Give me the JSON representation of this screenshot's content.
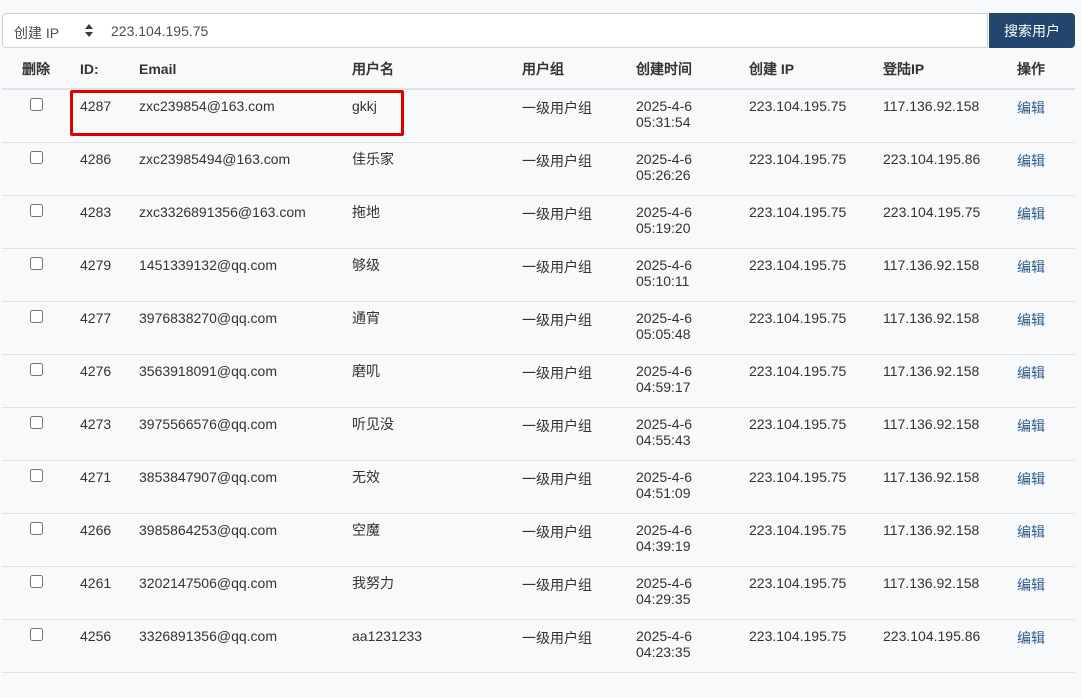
{
  "search": {
    "select_value": "创建 IP",
    "input_value": "223.104.195.75",
    "button_label": "搜索用户"
  },
  "table": {
    "headers": {
      "delete": "删除",
      "id": "ID:",
      "email": "Email",
      "username": "用户名",
      "group": "用户组",
      "created_time": "创建时间",
      "create_ip": "创建 IP",
      "login_ip": "登陆IP",
      "action": "操作"
    },
    "rows": [
      {
        "id": "4287",
        "email": "zxc239854@163.com",
        "username": "gkkj",
        "group": "一级用户组",
        "date": "2025-4-6",
        "time": "05:31:54",
        "create_ip": "223.104.195.75",
        "login_ip": "117.136.92.158",
        "action": "编辑"
      },
      {
        "id": "4286",
        "email": "zxc23985494@163.com",
        "username": "佳乐家",
        "group": "一级用户组",
        "date": "2025-4-6",
        "time": "05:26:26",
        "create_ip": "223.104.195.75",
        "login_ip": "223.104.195.86",
        "action": "编辑"
      },
      {
        "id": "4283",
        "email": "zxc3326891356@163.com",
        "username": "拖地",
        "group": "一级用户组",
        "date": "2025-4-6",
        "time": "05:19:20",
        "create_ip": "223.104.195.75",
        "login_ip": "223.104.195.75",
        "action": "编辑"
      },
      {
        "id": "4279",
        "email": "1451339132@qq.com",
        "username": "够级",
        "group": "一级用户组",
        "date": "2025-4-6",
        "time": "05:10:11",
        "create_ip": "223.104.195.75",
        "login_ip": "117.136.92.158",
        "action": "编辑"
      },
      {
        "id": "4277",
        "email": "3976838270@qq.com",
        "username": "通宵",
        "group": "一级用户组",
        "date": "2025-4-6",
        "time": "05:05:48",
        "create_ip": "223.104.195.75",
        "login_ip": "117.136.92.158",
        "action": "编辑"
      },
      {
        "id": "4276",
        "email": "3563918091@qq.com",
        "username": "磨叽",
        "group": "一级用户组",
        "date": "2025-4-6",
        "time": "04:59:17",
        "create_ip": "223.104.195.75",
        "login_ip": "117.136.92.158",
        "action": "编辑"
      },
      {
        "id": "4273",
        "email": "3975566576@qq.com",
        "username": "听见没",
        "group": "一级用户组",
        "date": "2025-4-6",
        "time": "04:55:43",
        "create_ip": "223.104.195.75",
        "login_ip": "117.136.92.158",
        "action": "编辑"
      },
      {
        "id": "4271",
        "email": "3853847907@qq.com",
        "username": "无效",
        "group": "一级用户组",
        "date": "2025-4-6",
        "time": "04:51:09",
        "create_ip": "223.104.195.75",
        "login_ip": "117.136.92.158",
        "action": "编辑"
      },
      {
        "id": "4266",
        "email": "3985864253@qq.com",
        "username": "空魔",
        "group": "一级用户组",
        "date": "2025-4-6",
        "time": "04:39:19",
        "create_ip": "223.104.195.75",
        "login_ip": "117.136.92.158",
        "action": "编辑"
      },
      {
        "id": "4261",
        "email": "3202147506@qq.com",
        "username": "我努力",
        "group": "一级用户组",
        "date": "2025-4-6",
        "time": "04:29:35",
        "create_ip": "223.104.195.75",
        "login_ip": "117.136.92.158",
        "action": "编辑"
      },
      {
        "id": "4256",
        "email": "3326891356@qq.com",
        "username": "aa1231233",
        "group": "一级用户组",
        "date": "2025-4-6",
        "time": "04:23:35",
        "create_ip": "223.104.195.75",
        "login_ip": "223.104.195.86",
        "action": "编辑"
      }
    ]
  },
  "colors": {
    "accent_button": "#23466f",
    "link": "#2e5b8a",
    "highlight": "#e00000",
    "background": "#f8f9fa"
  }
}
